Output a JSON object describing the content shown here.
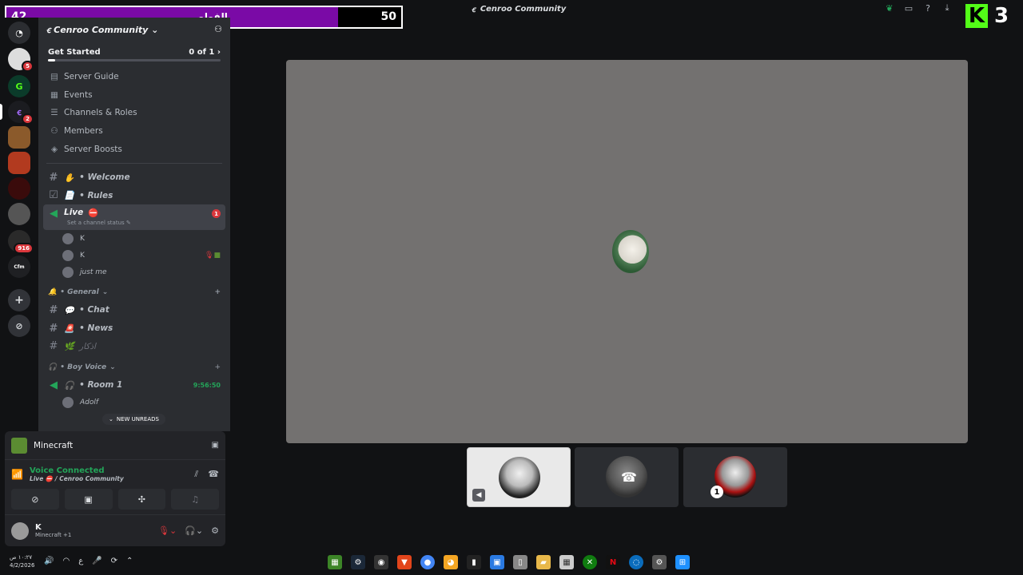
{
  "window": {
    "title": "Cenroo Community"
  },
  "overlay": {
    "left_value": "42",
    "label": "الفولو",
    "right_value": "50",
    "progress_fraction": 0.84
  },
  "stream_logo": {
    "letter": "K",
    "count": "3"
  },
  "server_rail": {
    "badges": [
      "5",
      "2",
      "916"
    ],
    "server_label": "Cfm"
  },
  "server": {
    "name": "Cenroo Community"
  },
  "get_started": {
    "label": "Get Started",
    "progress": "0 of 1"
  },
  "nav": [
    {
      "label": "Server Guide",
      "icon": "guide-icon"
    },
    {
      "label": "Events",
      "icon": "calendar-icon"
    },
    {
      "label": "Channels & Roles",
      "icon": "channels-icon"
    },
    {
      "label": "Members",
      "icon": "members-icon"
    },
    {
      "label": "Server Boosts",
      "icon": "boost-icon"
    }
  ],
  "channels": {
    "welcome": "• Welcome",
    "rules": "• Rules",
    "live": {
      "name": "Live",
      "status": "Set a channel status",
      "unread": "1"
    },
    "voice_users": [
      {
        "name": "K"
      },
      {
        "name": "K"
      },
      {
        "name": "just me"
      }
    ],
    "general_category": "• General",
    "chat": "• Chat",
    "news": "• News",
    "azkar": "اذكار",
    "boy_voice_category": "• Boy Voice",
    "room1": {
      "name": "• Room 1",
      "timer": "9:56:50"
    },
    "room1_user": "Adolf",
    "new_unreads": "NEW UNREADS"
  },
  "activity": {
    "game": "Minecraft"
  },
  "voice": {
    "status": "Voice Connected",
    "channel": "Live ⛔ / Cenroo Community"
  },
  "user": {
    "name": "K",
    "activity": "Minecraft +1"
  },
  "tiles": [
    {
      "label": "participant-1"
    },
    {
      "label": "participant-2"
    },
    {
      "label": "participant-3",
      "count": "1"
    }
  ],
  "taskbar": {
    "time": "١٠:٢٧ ص",
    "date": "4/2/2026",
    "lang": "ع"
  },
  "colors": {
    "accent_purple": "#7a0aa6",
    "kick_green": "#53fc18",
    "voice_green": "#23a559",
    "danger_red": "#da373c"
  }
}
